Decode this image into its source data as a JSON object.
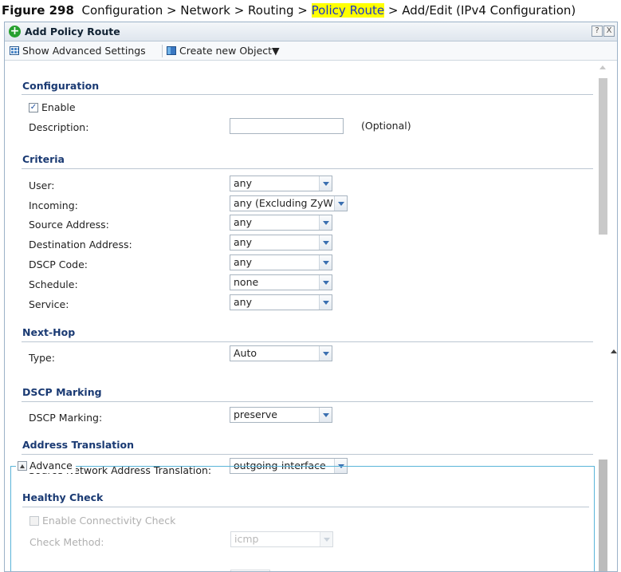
{
  "caption": {
    "figure_label": "Figure 298",
    "path_prefix": "Configuration > Network > Routing > ",
    "path_highlight": "Policy Route",
    "path_suffix": " > Add/Edit (IPv4 Configuration)"
  },
  "dialog": {
    "title": "Add Policy Route",
    "help_btn": "?",
    "close_btn": "X"
  },
  "toolbar": {
    "advanced": "Show Advanced Settings",
    "create_object": "Create new Object▼"
  },
  "configuration": {
    "title": "Configuration",
    "enable_label": "Enable",
    "enable_checked": true,
    "description_label": "Description:",
    "description_value": "",
    "optional_hint": "(Optional)"
  },
  "criteria": {
    "title": "Criteria",
    "user_label": "User:",
    "user_value": "any",
    "incoming_label": "Incoming:",
    "incoming_value": "any (Excluding ZyW",
    "source_label": "Source Address:",
    "source_value": "any",
    "destination_label": "Destination Address:",
    "destination_value": "any",
    "dscp_label": "DSCP Code:",
    "dscp_value": "any",
    "schedule_label": "Schedule:",
    "schedule_value": "none",
    "service_label": "Service:",
    "service_value": "any"
  },
  "nexthop": {
    "title": "Next-Hop",
    "type_label": "Type:",
    "type_value": "Auto"
  },
  "dscp_marking": {
    "title": "DSCP Marking",
    "label": "DSCP Marking:",
    "value": "preserve"
  },
  "address_translation": {
    "title": "Address Translation",
    "snat_label": "Source Network Address Translation:",
    "snat_value": "outgoing-interface"
  },
  "advance": {
    "legend": "Advance"
  },
  "healthy_check": {
    "title": "Healthy Check",
    "enable_label": "Enable Connectivity Check",
    "method_label": "Check Method:",
    "method_value": "icmp"
  }
}
